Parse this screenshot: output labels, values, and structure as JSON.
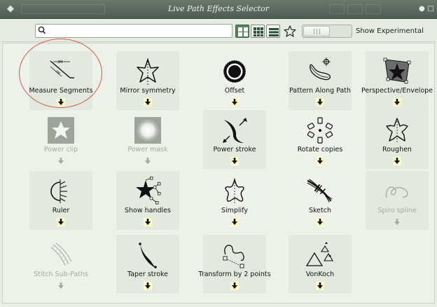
{
  "window": {
    "title": "Live Path Effects Selector"
  },
  "toolbar": {
    "search": {
      "value": "",
      "placeholder": ""
    },
    "show_experimental_label": "Show Experimental",
    "show_experimental_on": false
  },
  "effects": [
    {
      "label": "Measure Segments",
      "icon": "measure-segments-icon",
      "enabled": true
    },
    {
      "label": "Mirror symmetry",
      "icon": "mirror-symmetry-icon",
      "enabled": true
    },
    {
      "label": "Offset",
      "icon": "offset-icon",
      "enabled": true
    },
    {
      "label": "Pattern Along Path",
      "icon": "pattern-along-path-icon",
      "enabled": true
    },
    {
      "label": "Perspective/Envelope",
      "icon": "perspective-envelope-icon",
      "enabled": true
    },
    {
      "label": "Power clip",
      "icon": "power-clip-icon",
      "enabled": false
    },
    {
      "label": "Power mask",
      "icon": "power-mask-icon",
      "enabled": false
    },
    {
      "label": "Power stroke",
      "icon": "power-stroke-icon",
      "enabled": true
    },
    {
      "label": "Rotate copies",
      "icon": "rotate-copies-icon",
      "enabled": true
    },
    {
      "label": "Roughen",
      "icon": "roughen-icon",
      "enabled": true
    },
    {
      "label": "Ruler",
      "icon": "ruler-icon",
      "enabled": true
    },
    {
      "label": "Show handles",
      "icon": "show-handles-icon",
      "enabled": true
    },
    {
      "label": "Simplify",
      "icon": "simplify-icon",
      "enabled": true
    },
    {
      "label": "Sketch",
      "icon": "sketch-icon",
      "enabled": true
    },
    {
      "label": "Spiro spline",
      "icon": "spiro-spline-icon",
      "enabled": false
    },
    {
      "label": "Stitch Sub-Paths",
      "icon": "stitch-sub-paths-icon",
      "enabled": false
    },
    {
      "label": "Taper stroke",
      "icon": "taper-stroke-icon",
      "enabled": true
    },
    {
      "label": "Transform by 2 points",
      "icon": "transform-by-2-points-icon",
      "enabled": true
    },
    {
      "label": "VonKoch",
      "icon": "vonkoch-icon",
      "enabled": true
    }
  ]
}
